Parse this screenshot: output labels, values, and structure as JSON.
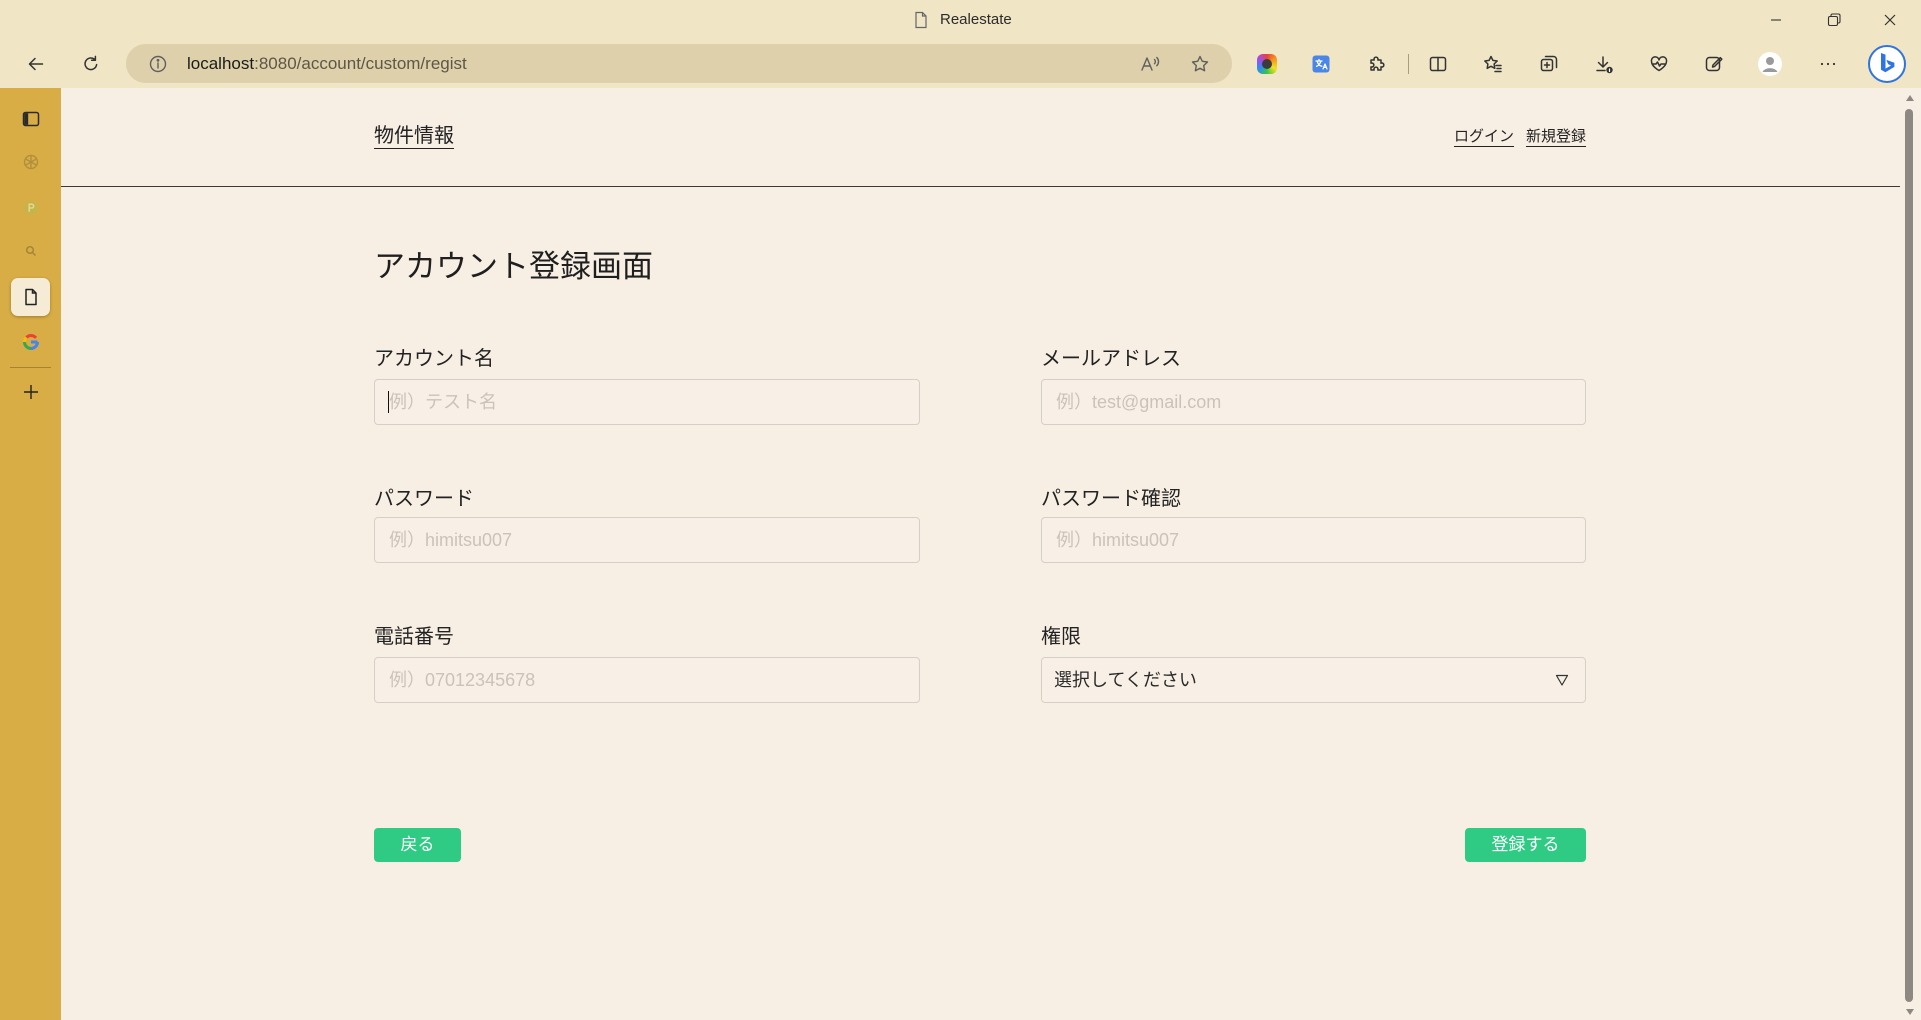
{
  "window": {
    "title": "Realestate",
    "controls": [
      "minimize-icon",
      "restore-icon",
      "close-icon"
    ]
  },
  "browser": {
    "url_host": "localhost",
    "url_path": ":8080/account/custom/regist",
    "toolbar_icons": [
      "back-arrow-icon",
      "refresh-icon",
      "site-info-icon",
      "read-aloud-icon",
      "favorite-star-icon",
      "color-extension-icon",
      "translate-extension-icon",
      "extensions-puzzle-icon",
      "split-screen-icon",
      "favorites-icon",
      "collections-icon",
      "downloads-icon",
      "browser-essentials-icon",
      "edit-note-icon",
      "profile-avatar-icon",
      "more-options-icon",
      "copilot-bing-icon"
    ],
    "sidebar_icons": [
      "tab-actions-icon",
      "chatgpt-icon",
      "p-app-icon",
      "search-icon",
      "document-icon",
      "google-icon",
      "add-icon"
    ]
  },
  "page": {
    "nav": {
      "brand": "物件情報",
      "login": "ログイン",
      "register": "新規登録"
    },
    "heading": "アカウント登録画面",
    "form": {
      "account_name": {
        "label": "アカウント名",
        "placeholder": "例）テスト名"
      },
      "email": {
        "label": "メールアドレス",
        "placeholder": "例）test@gmail.com"
      },
      "password": {
        "label": "パスワード",
        "placeholder": "例）himitsu007"
      },
      "password_confirm": {
        "label": "パスワード確認",
        "placeholder": "例）himitsu007"
      },
      "phone": {
        "label": "電話番号",
        "placeholder": "例）07012345678"
      },
      "role": {
        "label": "権限",
        "selected": "選択してください"
      }
    },
    "buttons": {
      "back": "戻る",
      "submit": "登録する"
    }
  },
  "colors": {
    "accent_green": "#2fcb85",
    "sidebar_gold": "#d9ad46",
    "page_background": "#f8efe4",
    "chrome_background": "#f0e5c4"
  }
}
